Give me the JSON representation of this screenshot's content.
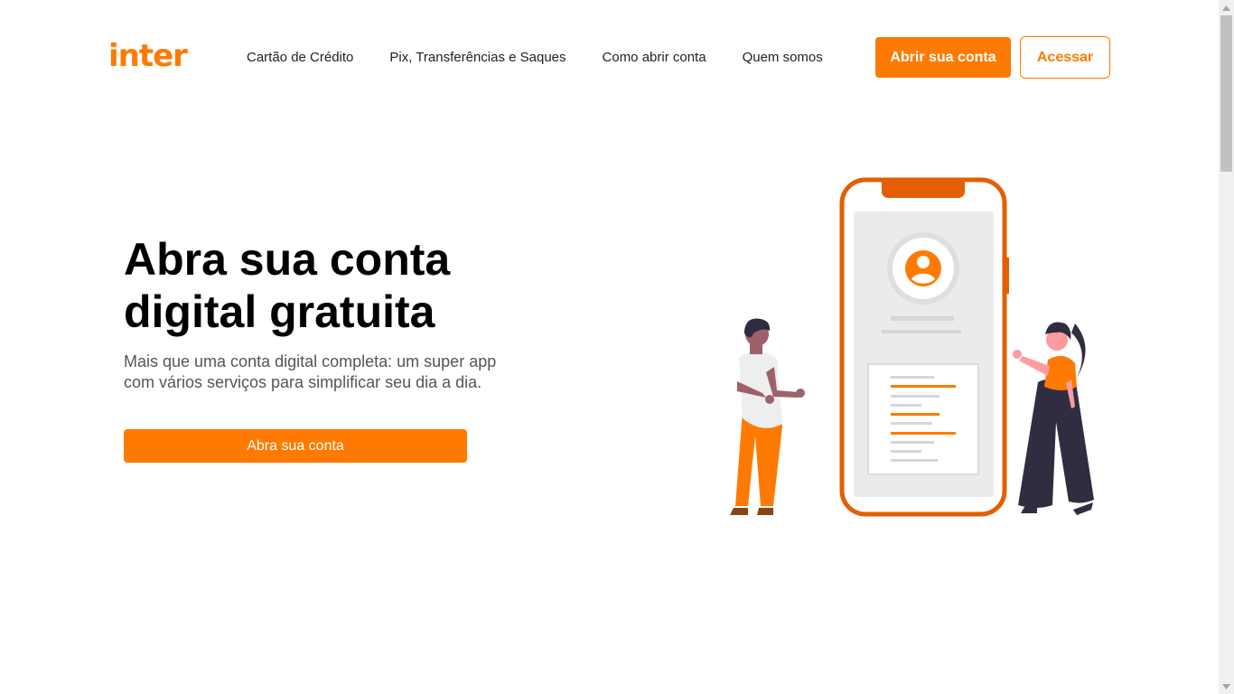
{
  "header": {
    "logo_text": "inter",
    "nav": [
      {
        "label": "Cartão de Crédito"
      },
      {
        "label": "Pix, Transferências e Saques"
      },
      {
        "label": "Como abrir conta"
      },
      {
        "label": "Quem somos"
      }
    ],
    "open_account_label": "Abrir sua conta",
    "access_label": "Acessar"
  },
  "hero": {
    "title_line1": "Abra sua conta",
    "title_line2": "digital gratuita",
    "subtitle_line1": "Mais que uma conta digital completa: um super app",
    "subtitle_line2": "com vários serviços para simplificar seu dia a dia.",
    "cta_label": "Abra sua conta"
  },
  "illustration": {
    "icons": [
      "phone-illustration",
      "user-avatar-icon",
      "man-figure",
      "woman-figure"
    ]
  },
  "colors": {
    "accent": "#ff7a00",
    "phone_frame": "#e35f00",
    "text_dark": "#000000",
    "text_muted": "#555555",
    "figure_dark": "#2f2e41"
  }
}
